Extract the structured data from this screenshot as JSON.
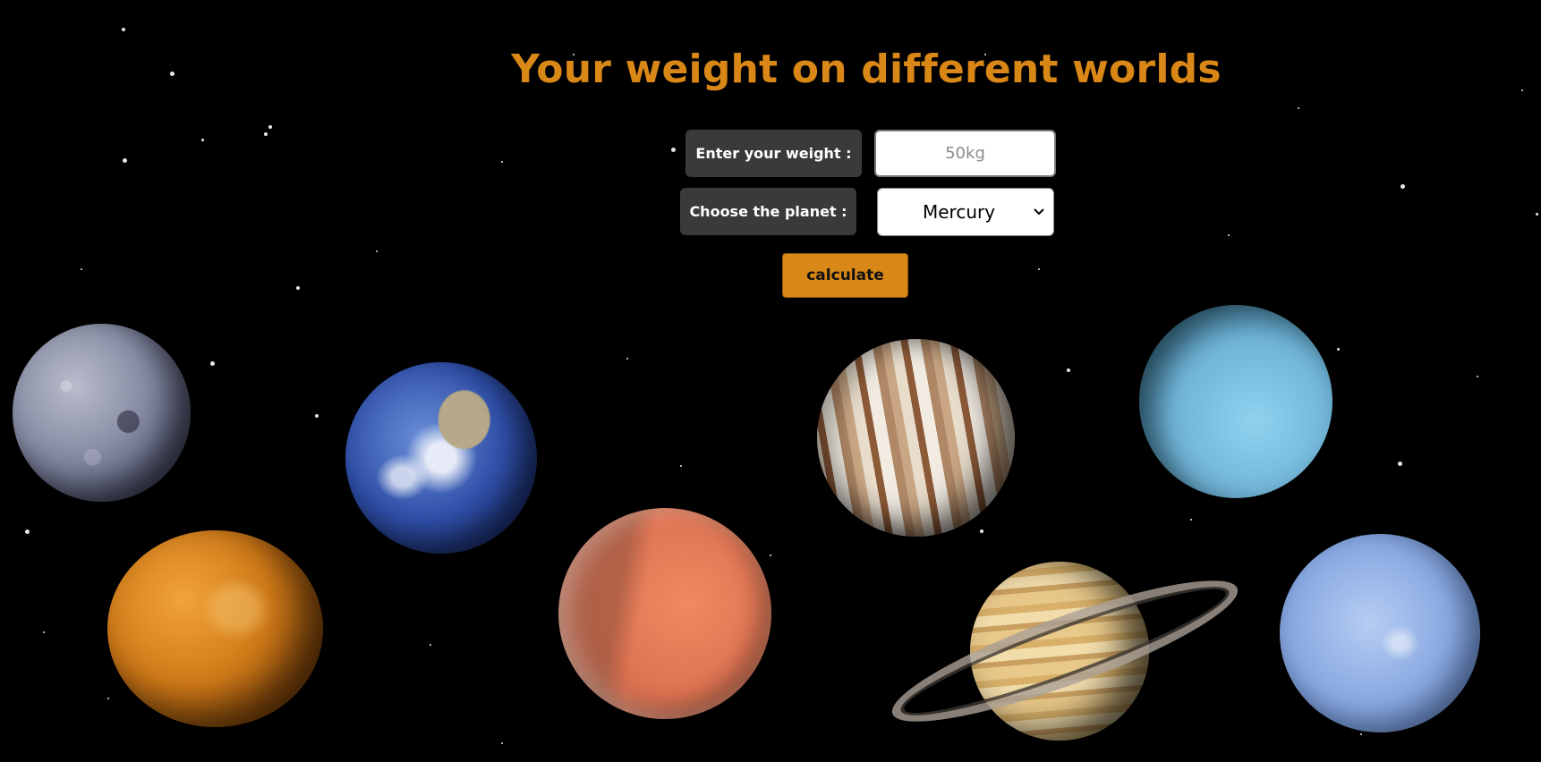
{
  "page": {
    "title": "Your weight on different worlds"
  },
  "form": {
    "weight_label": "Enter your weight :",
    "weight_placeholder": "50kg",
    "weight_value": "",
    "planet_label": "Choose the planet :",
    "planet_selected": "Mercury",
    "calculate_label": "calculate"
  },
  "colors": {
    "title": "#d98716",
    "button": "#d98716",
    "label_bg": "#3a3a3a",
    "background": "#000000"
  },
  "planets": [
    "Mercury",
    "Venus",
    "Earth",
    "Mars",
    "Jupiter",
    "Saturn",
    "Uranus",
    "Neptune"
  ]
}
